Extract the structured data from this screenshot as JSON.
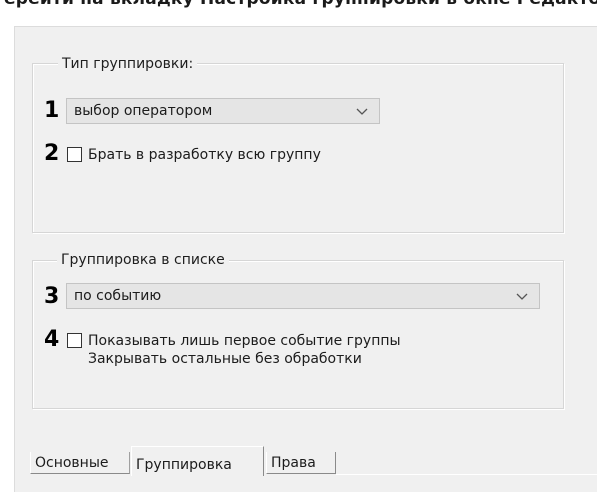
{
  "window": {
    "cutoff_title": "ерейти на вкладку Настройка группировки в окне ",
    "cutoff_title_bold": "Редактор"
  },
  "group_type": {
    "legend": "Тип группировки:",
    "marker1": "1",
    "select": {
      "value": "выбор оператором"
    },
    "marker2": "2",
    "checkbox": {
      "label": "Брать в разработку всю группу",
      "checked": false
    }
  },
  "group_list": {
    "legend": "Группировка в списке",
    "marker3": "3",
    "select": {
      "value": "по событию"
    },
    "marker4": "4",
    "checkbox": {
      "label_line1": "Показывать лишь первое событие группы",
      "label_line2": "Закрывать остальные без обработки",
      "checked": false
    }
  },
  "tabs": [
    {
      "label": "Основные",
      "active": false
    },
    {
      "label": "Группировка",
      "active": true
    },
    {
      "label": "Права",
      "active": false
    }
  ],
  "colors": {
    "dialog_bg": "#f0f0f0",
    "combo_bg": "#e5e5e5",
    "text": "#1c1c1c"
  },
  "icons": {
    "dropdown": "chevron-down-icon"
  }
}
